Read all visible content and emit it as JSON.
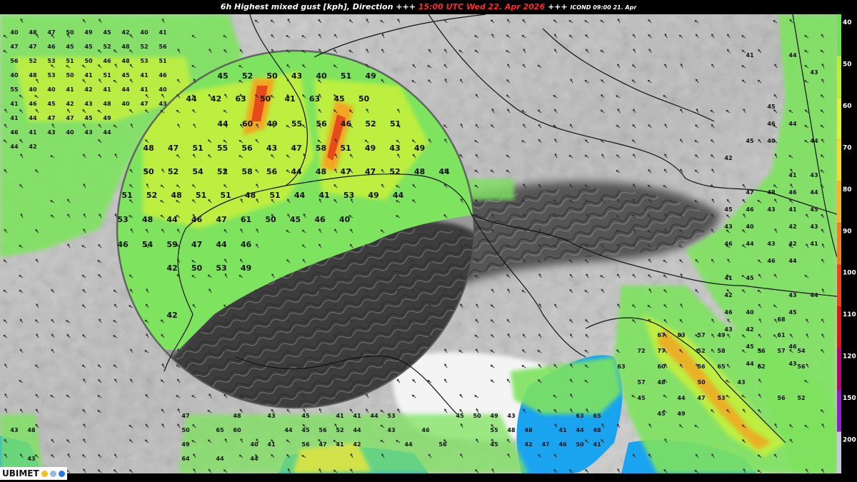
{
  "title": {
    "part1": "6h Highest mixed gust [kph], Direction +++ ",
    "time": "15:00 UTC Wed 22. Apr 2026",
    "part2": " +++ ",
    "model": "ICOND 09:00 21. Apr"
  },
  "logo": {
    "text": "UBIMET",
    "icons": [
      "sun-icon",
      "cloud-icon",
      "rain-drop-icon"
    ]
  },
  "legend": {
    "labels": [
      "40",
      "50",
      "60",
      "70",
      "80",
      "90",
      "100",
      "110",
      "120",
      "150",
      "200"
    ],
    "colors": [
      "#6ee05a",
      "#b6ee38",
      "#dcf23a",
      "#f2dc2e",
      "#f6b42a",
      "#f08020",
      "#e84818",
      "#d81a1a",
      "#b00a70",
      "#9020c8",
      "#c8c8d8"
    ]
  },
  "colors": {
    "gust40": "#7ee35f",
    "gust50": "#c4f03c",
    "gust60": "#f0e63a",
    "gust70": "#f2a624",
    "gust80": "#e2361a",
    "sea": "#1aa4f0",
    "border": "#111111"
  },
  "circle_values": [
    [
      {
        "v": "45"
      },
      {
        "v": "52"
      },
      {
        "v": "50"
      },
      {
        "v": "43"
      },
      {
        "v": "40"
      },
      {
        "v": "51"
      },
      {
        "v": "49"
      }
    ],
    [
      {
        "v": "44"
      },
      {
        "v": "42"
      },
      {
        "v": "63"
      },
      {
        "v": "50"
      },
      {
        "v": "41"
      },
      {
        "v": "63"
      },
      {
        "v": "45"
      },
      {
        "v": "50"
      }
    ],
    [
      {
        "v": "44"
      },
      {
        "v": "60"
      },
      {
        "v": "49"
      },
      {
        "v": "55"
      },
      {
        "v": "56"
      },
      {
        "v": "46"
      },
      {
        "v": "52"
      },
      {
        "v": "51"
      }
    ],
    [
      {
        "v": "48"
      },
      {
        "v": "47"
      },
      {
        "v": "51"
      },
      {
        "v": "55"
      },
      {
        "v": "56"
      },
      {
        "v": "43"
      },
      {
        "v": "47"
      },
      {
        "v": "58"
      },
      {
        "v": "51"
      },
      {
        "v": "49"
      },
      {
        "v": "43"
      },
      {
        "v": "49"
      }
    ],
    [
      {
        "v": "50"
      },
      {
        "v": "52"
      },
      {
        "v": "54"
      },
      {
        "v": "52"
      },
      {
        "v": "58"
      },
      {
        "v": "56"
      },
      {
        "v": "44"
      },
      {
        "v": "48"
      },
      {
        "v": "47"
      },
      {
        "v": "47"
      },
      {
        "v": "52"
      },
      {
        "v": "48"
      },
      {
        "v": "44"
      }
    ],
    [
      {
        "v": "51"
      },
      {
        "v": "52"
      },
      {
        "v": "48"
      },
      {
        "v": "51"
      },
      {
        "v": "51"
      },
      {
        "v": "48"
      },
      {
        "v": "51"
      },
      {
        "v": "44"
      },
      {
        "v": "41"
      },
      {
        "v": "53"
      },
      {
        "v": "49"
      },
      {
        "v": "44"
      }
    ],
    [
      {
        "v": "53"
      },
      {
        "v": "48"
      },
      {
        "v": "44"
      },
      {
        "v": "46"
      },
      {
        "v": "47"
      },
      {
        "v": "61"
      },
      {
        "v": "50"
      },
      {
        "v": "45"
      },
      {
        "v": "46"
      },
      {
        "v": "40"
      }
    ],
    [
      {
        "v": "46"
      },
      {
        "v": "54"
      },
      {
        "v": "59"
      },
      {
        "v": "47"
      },
      {
        "v": "44"
      },
      {
        "v": "46"
      }
    ],
    [
      {
        "v": "42"
      },
      {
        "v": "50"
      },
      {
        "v": "53"
      },
      {
        "v": "49"
      }
    ],
    [
      {
        "v": "42"
      }
    ]
  ],
  "small_values": [
    "40",
    "48",
    "47",
    "50",
    "49",
    "45",
    "42",
    "40",
    "41",
    "47",
    "47",
    "46",
    "45",
    "45",
    "52",
    "48",
    "52",
    "56",
    "56",
    "52",
    "53",
    "51",
    "50",
    "46",
    "48",
    "53",
    "51",
    "40",
    "48",
    "53",
    "50",
    "41",
    "51",
    "45",
    "41",
    "46",
    "55",
    "40",
    "40",
    "41",
    "42",
    "41",
    "44",
    "41",
    "40",
    "41",
    "46",
    "45",
    "42",
    "43",
    "48",
    "40",
    "47",
    "43",
    "41",
    "44",
    "47",
    "47",
    "45",
    "49",
    "46",
    "41",
    "43",
    "40",
    "43",
    "44",
    "44",
    "42"
  ],
  "east_values": [
    "41",
    "44",
    "43",
    "45",
    "46",
    "44",
    "45",
    "40",
    "44",
    "42",
    "41",
    "43",
    "47",
    "48",
    "46",
    "44",
    "45",
    "46",
    "43",
    "41",
    "45",
    "43",
    "40",
    "42",
    "43",
    "46",
    "44",
    "43",
    "42",
    "41",
    "46",
    "44",
    "41",
    "45",
    "42",
    "43",
    "44",
    "46",
    "40",
    "45",
    "43",
    "42",
    "45",
    "46",
    "44",
    "43"
  ],
  "adriatic_values": [
    "68",
    "67",
    "83",
    "57",
    "49",
    "61",
    "72",
    "77",
    "52",
    "58",
    "56",
    "57",
    "54",
    "63",
    "60",
    "56",
    "65",
    "62",
    "56",
    "57",
    "48",
    "50",
    "43",
    "45",
    "44",
    "47",
    "53",
    "56",
    "52",
    "45",
    "49"
  ],
  "south_values": [
    "47",
    "48",
    "43",
    "45",
    "41",
    "41",
    "44",
    "53",
    "45",
    "50",
    "49",
    "43",
    "63",
    "65",
    "43",
    "48",
    "50",
    "65",
    "60",
    "44",
    "45",
    "56",
    "52",
    "44",
    "43",
    "46",
    "55",
    "48",
    "48",
    "41",
    "44",
    "48",
    "49",
    "40",
    "41",
    "56",
    "47",
    "41",
    "42",
    "44",
    "56",
    "45",
    "42",
    "47",
    "46",
    "50",
    "41",
    "43",
    "64",
    "44",
    "44"
  ]
}
